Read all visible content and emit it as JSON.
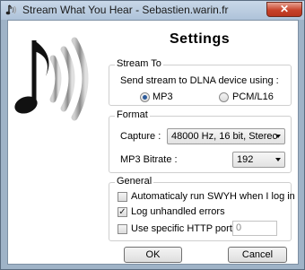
{
  "window": {
    "title": "Stream What You Hear - Sebastien.warin.fr",
    "close_glyph": "✕"
  },
  "header": {
    "title": "Settings"
  },
  "stream_to": {
    "legend": "Stream To",
    "description": "Send stream to DLNA device using :",
    "options": [
      {
        "label": "MP3",
        "selected": true
      },
      {
        "label": "PCM/L16",
        "selected": false
      }
    ]
  },
  "format": {
    "legend": "Format",
    "capture_label": "Capture :",
    "capture_value": "48000 Hz, 16 bit, Stereo",
    "bitrate_label": "MP3 Bitrate :",
    "bitrate_value": "192"
  },
  "general": {
    "legend": "General",
    "autorun": {
      "label": "Automaticaly run SWYH when I log in",
      "checked": false
    },
    "log_errors": {
      "label": "Log unhandled errors",
      "checked": true,
      "check_glyph": "✓"
    },
    "http_port": {
      "label": "Use specific HTTP port :",
      "checked": false,
      "value": "0"
    }
  },
  "buttons": {
    "ok": "OK",
    "cancel": "Cancel"
  }
}
